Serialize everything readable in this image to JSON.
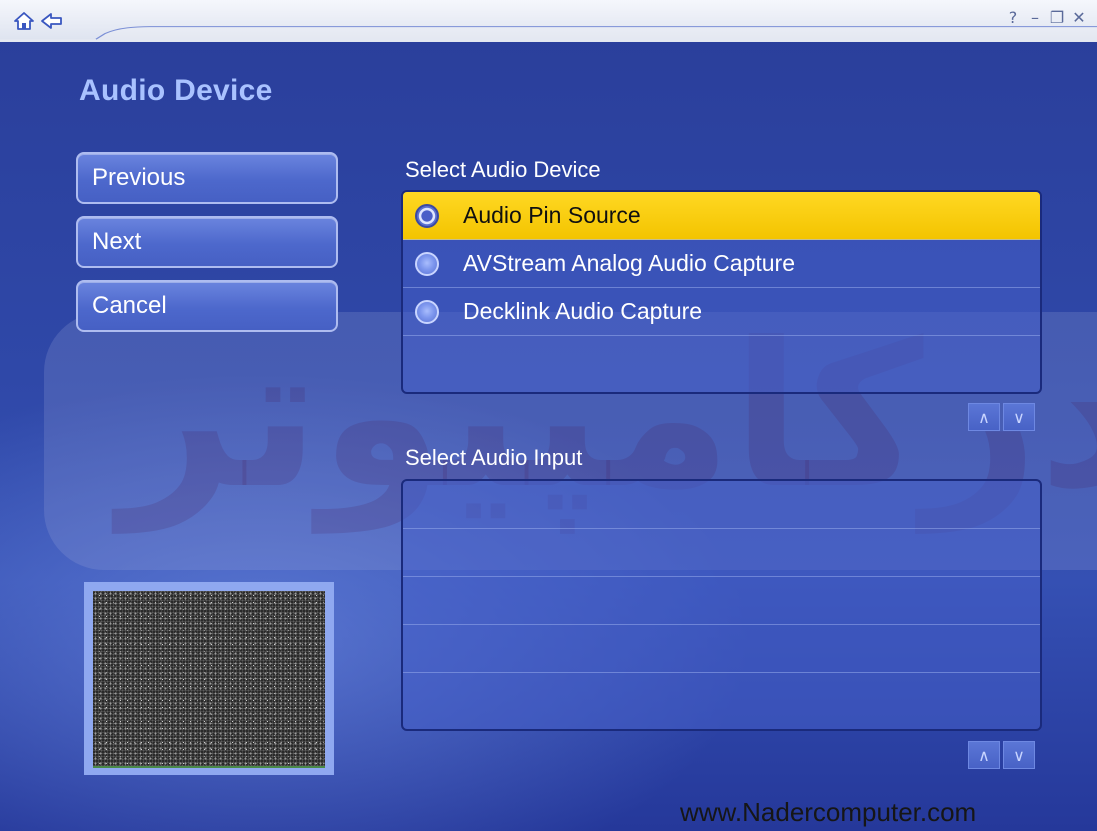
{
  "window": {
    "help": "?",
    "minimize": "–",
    "restore": "❐",
    "close": "✕"
  },
  "page_title": "Audio Device",
  "nav_buttons": {
    "previous": "Previous",
    "next": "Next",
    "cancel": "Cancel"
  },
  "audio_device": {
    "label": "Select Audio Device",
    "items": [
      {
        "label": "Audio Pin Source",
        "selected": true
      },
      {
        "label": "AVStream Analog Audio Capture",
        "selected": false
      },
      {
        "label": "Decklink Audio Capture",
        "selected": false
      }
    ]
  },
  "audio_input": {
    "label": "Select Audio Input"
  },
  "scroll": {
    "up": "∧",
    "down": "∨"
  },
  "watermark": "نادرکامپیوتر",
  "footer_url": "www.Nadercomputer.com",
  "colors": {
    "background": "#2f48a8",
    "accent_selected": "#ffd823",
    "title_text": "#a9c2ff"
  },
  "icons": {
    "home": "home-icon",
    "back": "back-arrow-icon"
  }
}
